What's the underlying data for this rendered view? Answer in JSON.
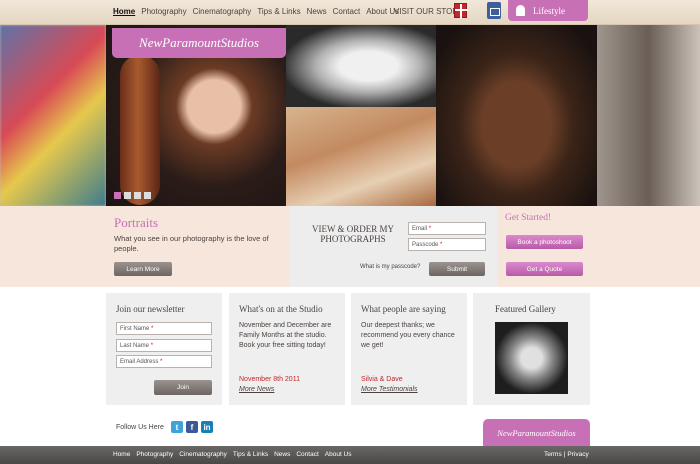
{
  "topnav": {
    "items": [
      "Home",
      "Photography",
      "Cinematography",
      "Tips & Links",
      "News",
      "Contact",
      "About Us"
    ],
    "store": "VISIT OUR STORE",
    "lifestyle": "Lifestyle"
  },
  "hero": {
    "logo": "NewParamountStudios",
    "slides": 4,
    "active_slide": 1
  },
  "portraits": {
    "title": "Portraits",
    "text": "What you see in our photography is the love of people.",
    "button": "Learn More"
  },
  "order": {
    "title": "VIEW & ORDER MY PHOTOGRAPHS",
    "email_label": "Email",
    "passcode_label": "Passcode",
    "required": "*",
    "passcode_question": "What is my passcode?",
    "submit": "Submit"
  },
  "getstarted": {
    "title": "Get Started!",
    "book": "Book a photoshoot",
    "quote": "Get a Quote"
  },
  "newsletter": {
    "title": "Join our newsletter",
    "first": "First Name",
    "last": "Last Name",
    "email": "Email Address",
    "required": "*",
    "button": "Join"
  },
  "studio": {
    "title": "What's on at the Studio",
    "text": "November and December are Family Months at the studio. Book your free sitting today!",
    "date": "November 8th 2011",
    "more": "More News"
  },
  "testimonials": {
    "title": "What people are saying",
    "text": "Our deepest thanks; we recommend you every chance we get!",
    "author": "Silvia & Dave",
    "more": "More Testimonials"
  },
  "gallery": {
    "title": "Featured Gallery"
  },
  "follow": {
    "label": "Follow Us Here",
    "twitter": "t",
    "facebook": "f",
    "linkedin": "in"
  },
  "footer": {
    "logo": "NewParamountStudios",
    "items": [
      "Home",
      "Photography",
      "Cinematography",
      "Tips & Links",
      "News",
      "Contact",
      "About Us"
    ],
    "terms": "Terms",
    "sep": "|",
    "privacy": "Privacy"
  },
  "colors": {
    "accent": "#c770b5",
    "topbar": "#e4d6c2",
    "footer": "#4a4847"
  }
}
